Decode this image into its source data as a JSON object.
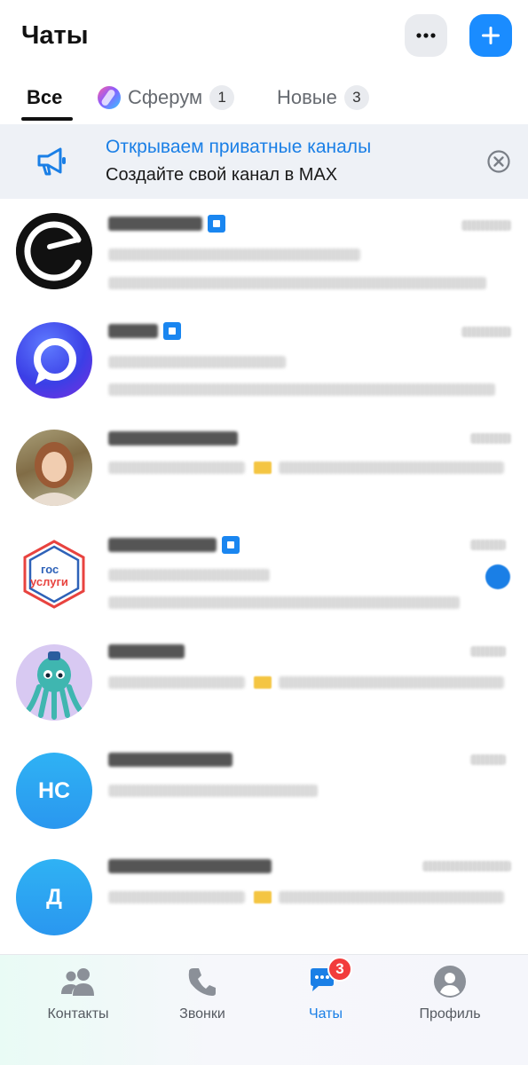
{
  "header": {
    "title": "Чаты",
    "more_icon": "more-horizontal-icon",
    "add_icon": "plus-icon",
    "accent_color": "#1a8cff"
  },
  "tabs": [
    {
      "label": "Все",
      "active": true
    },
    {
      "label": "Сферум",
      "count": "1",
      "icon": "sferum-logo-icon"
    },
    {
      "label": "Новые",
      "count": "3"
    }
  ],
  "banner": {
    "title": "Открываем приватные каналы",
    "subtitle": "Создайте свой канал в MAX",
    "icon": "megaphone-icon",
    "close_icon": "close-circle-icon"
  },
  "chats": [
    {
      "avatar": "black-logo",
      "verified": true,
      "unread": false
    },
    {
      "avatar": "max-logo",
      "verified": true,
      "unread": false
    },
    {
      "avatar": "photo-girl",
      "verified": false,
      "unread": false
    },
    {
      "avatar": "gosuslugi-logo",
      "avatar_text_top": "гос",
      "avatar_text_bottom": "услуги",
      "verified": true,
      "unread": true
    },
    {
      "avatar": "octopus",
      "verified": false,
      "unread": false
    },
    {
      "avatar": "initials",
      "initials": "НС",
      "verified": false,
      "unread": false
    },
    {
      "avatar": "initials",
      "initials": "Д",
      "verified": false,
      "unread": false
    }
  ],
  "bottom_nav": {
    "contacts": {
      "label": "Контакты",
      "icon": "contacts-icon"
    },
    "calls": {
      "label": "Звонки",
      "icon": "phone-icon"
    },
    "chats": {
      "label": "Чаты",
      "icon": "chat-bubbles-icon",
      "badge": "3",
      "active": true
    },
    "profile": {
      "label": "Профиль",
      "icon": "profile-icon"
    }
  }
}
